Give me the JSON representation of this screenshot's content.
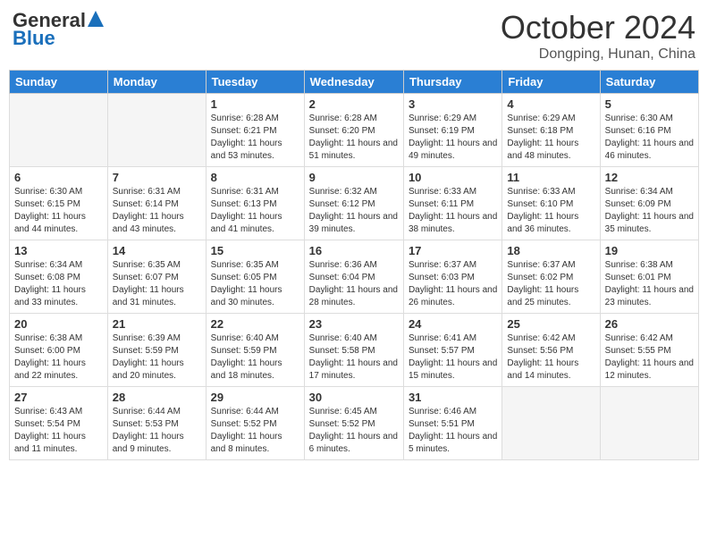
{
  "header": {
    "logo_general": "General",
    "logo_blue": "Blue",
    "month_title": "October 2024",
    "location": "Dongping, Hunan, China"
  },
  "days_of_week": [
    "Sunday",
    "Monday",
    "Tuesday",
    "Wednesday",
    "Thursday",
    "Friday",
    "Saturday"
  ],
  "weeks": [
    [
      {
        "num": "",
        "sunrise": "",
        "sunset": "",
        "daylight": "",
        "empty": true
      },
      {
        "num": "",
        "sunrise": "",
        "sunset": "",
        "daylight": "",
        "empty": true
      },
      {
        "num": "1",
        "sunrise": "Sunrise: 6:28 AM",
        "sunset": "Sunset: 6:21 PM",
        "daylight": "Daylight: 11 hours and 53 minutes."
      },
      {
        "num": "2",
        "sunrise": "Sunrise: 6:28 AM",
        "sunset": "Sunset: 6:20 PM",
        "daylight": "Daylight: 11 hours and 51 minutes."
      },
      {
        "num": "3",
        "sunrise": "Sunrise: 6:29 AM",
        "sunset": "Sunset: 6:19 PM",
        "daylight": "Daylight: 11 hours and 49 minutes."
      },
      {
        "num": "4",
        "sunrise": "Sunrise: 6:29 AM",
        "sunset": "Sunset: 6:18 PM",
        "daylight": "Daylight: 11 hours and 48 minutes."
      },
      {
        "num": "5",
        "sunrise": "Sunrise: 6:30 AM",
        "sunset": "Sunset: 6:16 PM",
        "daylight": "Daylight: 11 hours and 46 minutes."
      }
    ],
    [
      {
        "num": "6",
        "sunrise": "Sunrise: 6:30 AM",
        "sunset": "Sunset: 6:15 PM",
        "daylight": "Daylight: 11 hours and 44 minutes."
      },
      {
        "num": "7",
        "sunrise": "Sunrise: 6:31 AM",
        "sunset": "Sunset: 6:14 PM",
        "daylight": "Daylight: 11 hours and 43 minutes."
      },
      {
        "num": "8",
        "sunrise": "Sunrise: 6:31 AM",
        "sunset": "Sunset: 6:13 PM",
        "daylight": "Daylight: 11 hours and 41 minutes."
      },
      {
        "num": "9",
        "sunrise": "Sunrise: 6:32 AM",
        "sunset": "Sunset: 6:12 PM",
        "daylight": "Daylight: 11 hours and 39 minutes."
      },
      {
        "num": "10",
        "sunrise": "Sunrise: 6:33 AM",
        "sunset": "Sunset: 6:11 PM",
        "daylight": "Daylight: 11 hours and 38 minutes."
      },
      {
        "num": "11",
        "sunrise": "Sunrise: 6:33 AM",
        "sunset": "Sunset: 6:10 PM",
        "daylight": "Daylight: 11 hours and 36 minutes."
      },
      {
        "num": "12",
        "sunrise": "Sunrise: 6:34 AM",
        "sunset": "Sunset: 6:09 PM",
        "daylight": "Daylight: 11 hours and 35 minutes."
      }
    ],
    [
      {
        "num": "13",
        "sunrise": "Sunrise: 6:34 AM",
        "sunset": "Sunset: 6:08 PM",
        "daylight": "Daylight: 11 hours and 33 minutes."
      },
      {
        "num": "14",
        "sunrise": "Sunrise: 6:35 AM",
        "sunset": "Sunset: 6:07 PM",
        "daylight": "Daylight: 11 hours and 31 minutes."
      },
      {
        "num": "15",
        "sunrise": "Sunrise: 6:35 AM",
        "sunset": "Sunset: 6:05 PM",
        "daylight": "Daylight: 11 hours and 30 minutes."
      },
      {
        "num": "16",
        "sunrise": "Sunrise: 6:36 AM",
        "sunset": "Sunset: 6:04 PM",
        "daylight": "Daylight: 11 hours and 28 minutes."
      },
      {
        "num": "17",
        "sunrise": "Sunrise: 6:37 AM",
        "sunset": "Sunset: 6:03 PM",
        "daylight": "Daylight: 11 hours and 26 minutes."
      },
      {
        "num": "18",
        "sunrise": "Sunrise: 6:37 AM",
        "sunset": "Sunset: 6:02 PM",
        "daylight": "Daylight: 11 hours and 25 minutes."
      },
      {
        "num": "19",
        "sunrise": "Sunrise: 6:38 AM",
        "sunset": "Sunset: 6:01 PM",
        "daylight": "Daylight: 11 hours and 23 minutes."
      }
    ],
    [
      {
        "num": "20",
        "sunrise": "Sunrise: 6:38 AM",
        "sunset": "Sunset: 6:00 PM",
        "daylight": "Daylight: 11 hours and 22 minutes."
      },
      {
        "num": "21",
        "sunrise": "Sunrise: 6:39 AM",
        "sunset": "Sunset: 5:59 PM",
        "daylight": "Daylight: 11 hours and 20 minutes."
      },
      {
        "num": "22",
        "sunrise": "Sunrise: 6:40 AM",
        "sunset": "Sunset: 5:59 PM",
        "daylight": "Daylight: 11 hours and 18 minutes."
      },
      {
        "num": "23",
        "sunrise": "Sunrise: 6:40 AM",
        "sunset": "Sunset: 5:58 PM",
        "daylight": "Daylight: 11 hours and 17 minutes."
      },
      {
        "num": "24",
        "sunrise": "Sunrise: 6:41 AM",
        "sunset": "Sunset: 5:57 PM",
        "daylight": "Daylight: 11 hours and 15 minutes."
      },
      {
        "num": "25",
        "sunrise": "Sunrise: 6:42 AM",
        "sunset": "Sunset: 5:56 PM",
        "daylight": "Daylight: 11 hours and 14 minutes."
      },
      {
        "num": "26",
        "sunrise": "Sunrise: 6:42 AM",
        "sunset": "Sunset: 5:55 PM",
        "daylight": "Daylight: 11 hours and 12 minutes."
      }
    ],
    [
      {
        "num": "27",
        "sunrise": "Sunrise: 6:43 AM",
        "sunset": "Sunset: 5:54 PM",
        "daylight": "Daylight: 11 hours and 11 minutes."
      },
      {
        "num": "28",
        "sunrise": "Sunrise: 6:44 AM",
        "sunset": "Sunset: 5:53 PM",
        "daylight": "Daylight: 11 hours and 9 minutes."
      },
      {
        "num": "29",
        "sunrise": "Sunrise: 6:44 AM",
        "sunset": "Sunset: 5:52 PM",
        "daylight": "Daylight: 11 hours and 8 minutes."
      },
      {
        "num": "30",
        "sunrise": "Sunrise: 6:45 AM",
        "sunset": "Sunset: 5:52 PM",
        "daylight": "Daylight: 11 hours and 6 minutes."
      },
      {
        "num": "31",
        "sunrise": "Sunrise: 6:46 AM",
        "sunset": "Sunset: 5:51 PM",
        "daylight": "Daylight: 11 hours and 5 minutes."
      },
      {
        "num": "",
        "sunrise": "",
        "sunset": "",
        "daylight": "",
        "empty": true
      },
      {
        "num": "",
        "sunrise": "",
        "sunset": "",
        "daylight": "",
        "empty": true
      }
    ]
  ]
}
